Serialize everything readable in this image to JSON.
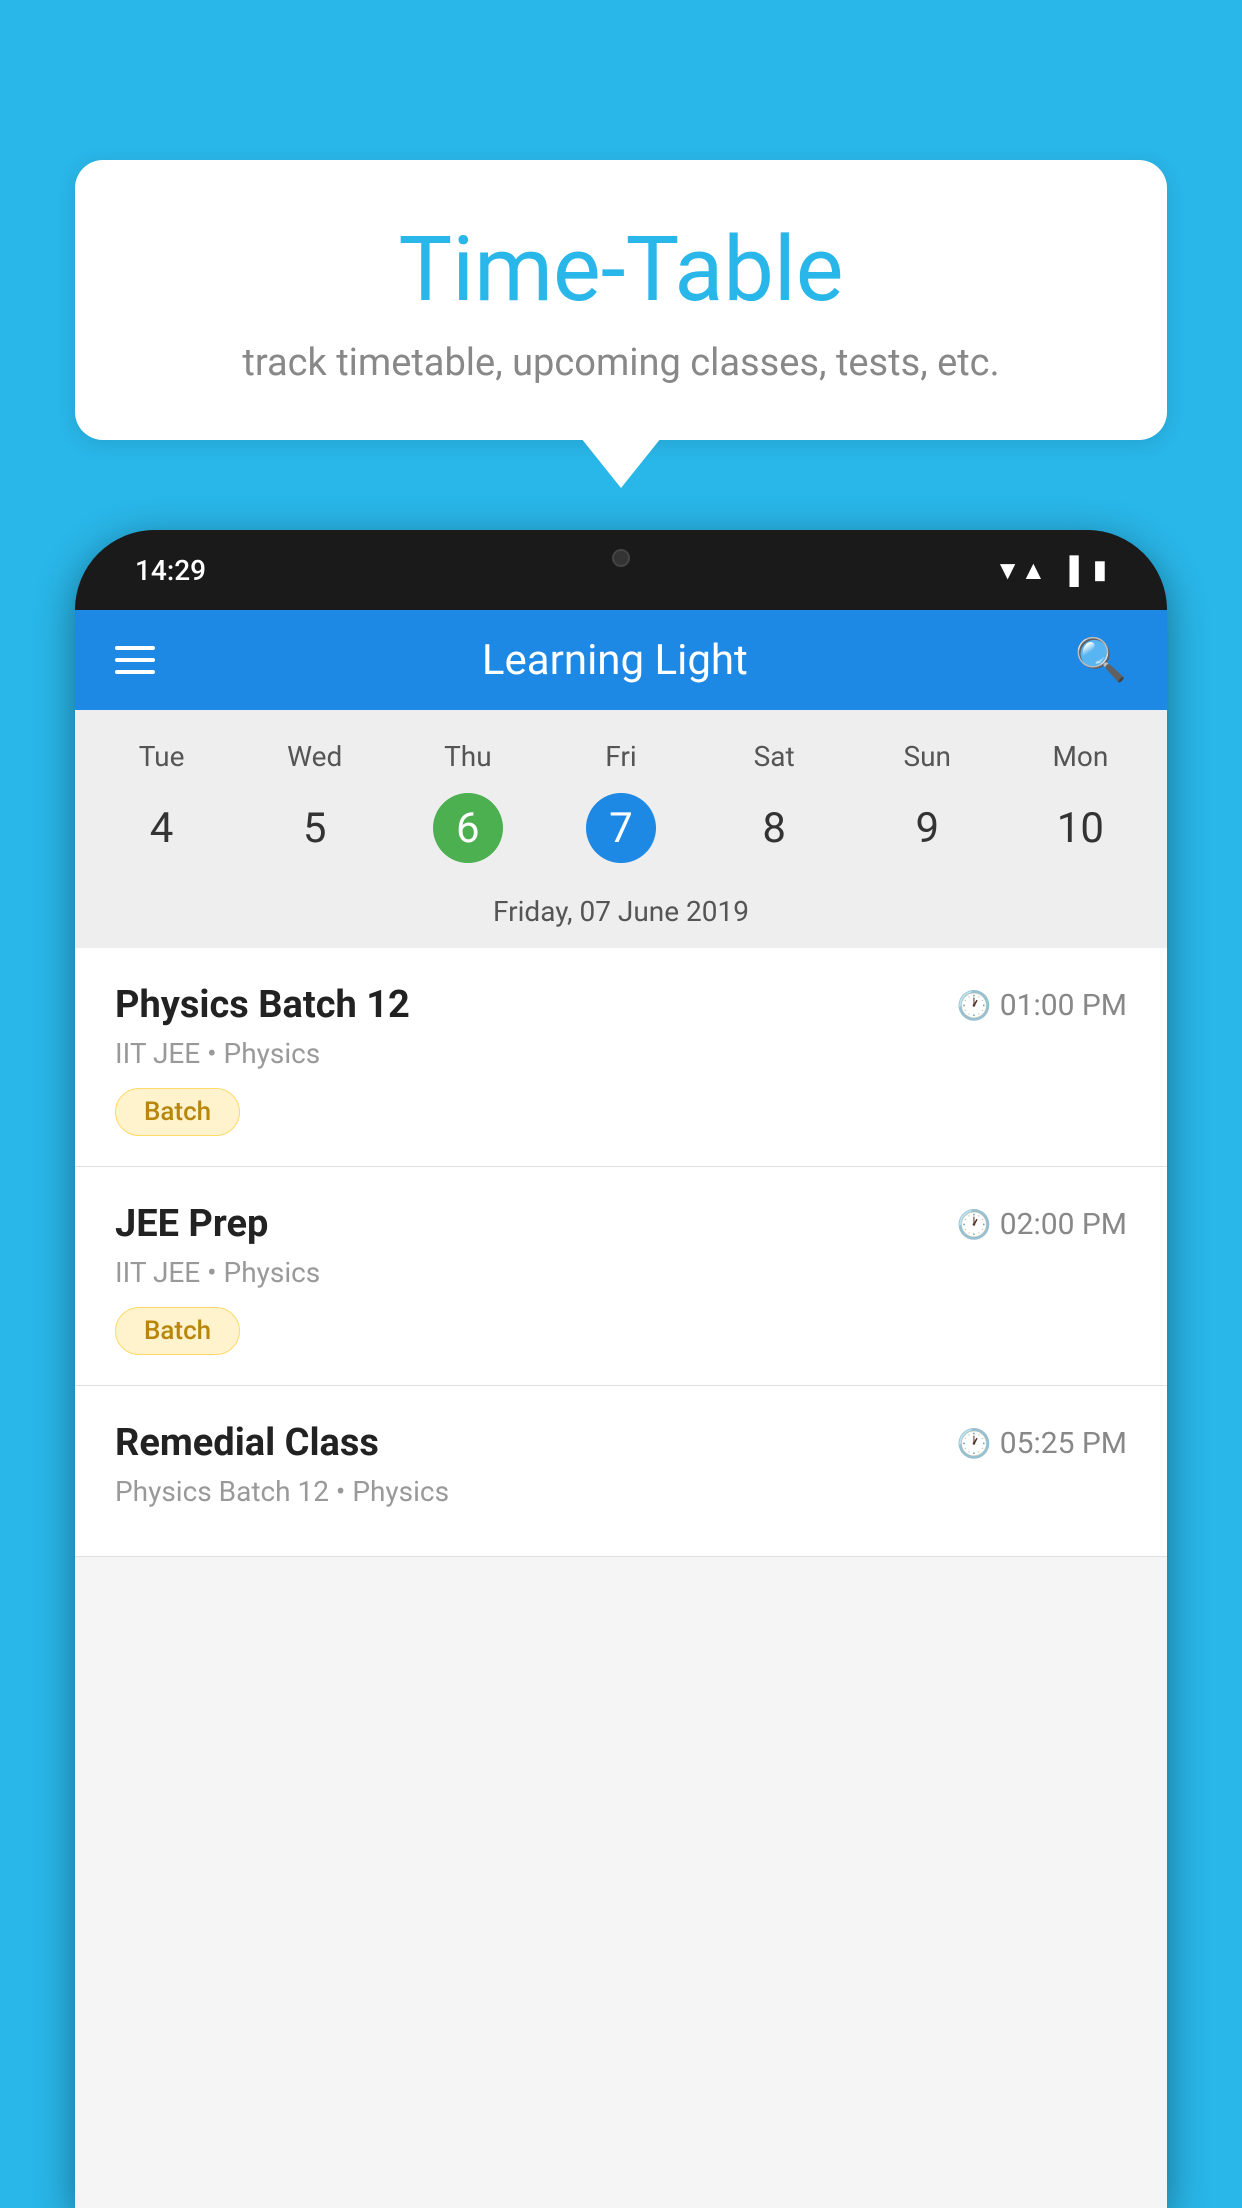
{
  "background_color": "#29b6e8",
  "bubble": {
    "title": "Time-Table",
    "subtitle": "track timetable, upcoming classes, tests, etc."
  },
  "phone": {
    "status_bar": {
      "time": "14:29",
      "icons": [
        "wifi",
        "signal",
        "battery"
      ]
    },
    "header": {
      "title": "Learning Light",
      "hamburger_label": "menu",
      "search_label": "search"
    },
    "calendar": {
      "days": [
        {
          "label": "Tue",
          "number": "4"
        },
        {
          "label": "Wed",
          "number": "5"
        },
        {
          "label": "Thu",
          "number": "6",
          "state": "today"
        },
        {
          "label": "Fri",
          "number": "7",
          "state": "selected"
        },
        {
          "label": "Sat",
          "number": "8"
        },
        {
          "label": "Sun",
          "number": "9"
        },
        {
          "label": "Mon",
          "number": "10"
        }
      ],
      "selected_date": "Friday, 07 June 2019"
    },
    "schedule": [
      {
        "title": "Physics Batch 12",
        "time": "01:00 PM",
        "subtitle": "IIT JEE • Physics",
        "badge": "Batch"
      },
      {
        "title": "JEE Prep",
        "time": "02:00 PM",
        "subtitle": "IIT JEE • Physics",
        "badge": "Batch"
      },
      {
        "title": "Remedial Class",
        "time": "05:25 PM",
        "subtitle": "Physics Batch 12 • Physics",
        "badge": null
      }
    ]
  }
}
